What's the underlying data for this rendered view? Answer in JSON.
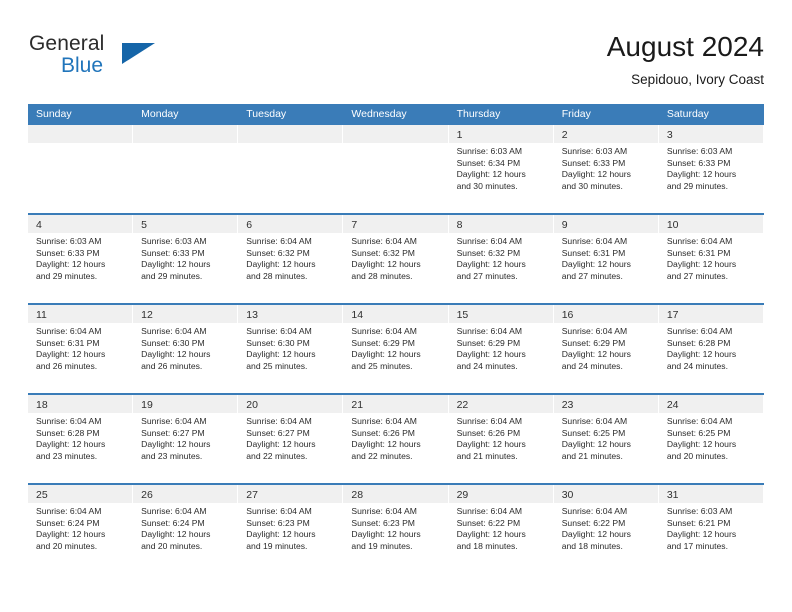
{
  "brand": {
    "name_part1": "General",
    "name_part2": "Blue",
    "flag_icon": "blue-triangle-flag-icon"
  },
  "header": {
    "title": "August 2024",
    "subtitle": "Sepidouo, Ivory Coast"
  },
  "colors": {
    "header_blue": "#3a7cb8",
    "brand_blue": "#2175bb",
    "day_band_gray": "#f0f0f0",
    "text": "#2b2b2b"
  },
  "weekdays": [
    "Sunday",
    "Monday",
    "Tuesday",
    "Wednesday",
    "Thursday",
    "Friday",
    "Saturday"
  ],
  "weeks": [
    [
      {
        "day": "",
        "empty": true
      },
      {
        "day": "",
        "empty": true
      },
      {
        "day": "",
        "empty": true
      },
      {
        "day": "",
        "empty": true
      },
      {
        "day": "1",
        "sunrise": "Sunrise: 6:03 AM",
        "sunset": "Sunset: 6:34 PM",
        "daylight_line1": "Daylight: 12 hours",
        "daylight_line2": "and 30 minutes."
      },
      {
        "day": "2",
        "sunrise": "Sunrise: 6:03 AM",
        "sunset": "Sunset: 6:33 PM",
        "daylight_line1": "Daylight: 12 hours",
        "daylight_line2": "and 30 minutes."
      },
      {
        "day": "3",
        "sunrise": "Sunrise: 6:03 AM",
        "sunset": "Sunset: 6:33 PM",
        "daylight_line1": "Daylight: 12 hours",
        "daylight_line2": "and 29 minutes."
      }
    ],
    [
      {
        "day": "4",
        "sunrise": "Sunrise: 6:03 AM",
        "sunset": "Sunset: 6:33 PM",
        "daylight_line1": "Daylight: 12 hours",
        "daylight_line2": "and 29 minutes."
      },
      {
        "day": "5",
        "sunrise": "Sunrise: 6:03 AM",
        "sunset": "Sunset: 6:33 PM",
        "daylight_line1": "Daylight: 12 hours",
        "daylight_line2": "and 29 minutes."
      },
      {
        "day": "6",
        "sunrise": "Sunrise: 6:04 AM",
        "sunset": "Sunset: 6:32 PM",
        "daylight_line1": "Daylight: 12 hours",
        "daylight_line2": "and 28 minutes."
      },
      {
        "day": "7",
        "sunrise": "Sunrise: 6:04 AM",
        "sunset": "Sunset: 6:32 PM",
        "daylight_line1": "Daylight: 12 hours",
        "daylight_line2": "and 28 minutes."
      },
      {
        "day": "8",
        "sunrise": "Sunrise: 6:04 AM",
        "sunset": "Sunset: 6:32 PM",
        "daylight_line1": "Daylight: 12 hours",
        "daylight_line2": "and 27 minutes."
      },
      {
        "day": "9",
        "sunrise": "Sunrise: 6:04 AM",
        "sunset": "Sunset: 6:31 PM",
        "daylight_line1": "Daylight: 12 hours",
        "daylight_line2": "and 27 minutes."
      },
      {
        "day": "10",
        "sunrise": "Sunrise: 6:04 AM",
        "sunset": "Sunset: 6:31 PM",
        "daylight_line1": "Daylight: 12 hours",
        "daylight_line2": "and 27 minutes."
      }
    ],
    [
      {
        "day": "11",
        "sunrise": "Sunrise: 6:04 AM",
        "sunset": "Sunset: 6:31 PM",
        "daylight_line1": "Daylight: 12 hours",
        "daylight_line2": "and 26 minutes."
      },
      {
        "day": "12",
        "sunrise": "Sunrise: 6:04 AM",
        "sunset": "Sunset: 6:30 PM",
        "daylight_line1": "Daylight: 12 hours",
        "daylight_line2": "and 26 minutes."
      },
      {
        "day": "13",
        "sunrise": "Sunrise: 6:04 AM",
        "sunset": "Sunset: 6:30 PM",
        "daylight_line1": "Daylight: 12 hours",
        "daylight_line2": "and 25 minutes."
      },
      {
        "day": "14",
        "sunrise": "Sunrise: 6:04 AM",
        "sunset": "Sunset: 6:29 PM",
        "daylight_line1": "Daylight: 12 hours",
        "daylight_line2": "and 25 minutes."
      },
      {
        "day": "15",
        "sunrise": "Sunrise: 6:04 AM",
        "sunset": "Sunset: 6:29 PM",
        "daylight_line1": "Daylight: 12 hours",
        "daylight_line2": "and 24 minutes."
      },
      {
        "day": "16",
        "sunrise": "Sunrise: 6:04 AM",
        "sunset": "Sunset: 6:29 PM",
        "daylight_line1": "Daylight: 12 hours",
        "daylight_line2": "and 24 minutes."
      },
      {
        "day": "17",
        "sunrise": "Sunrise: 6:04 AM",
        "sunset": "Sunset: 6:28 PM",
        "daylight_line1": "Daylight: 12 hours",
        "daylight_line2": "and 24 minutes."
      }
    ],
    [
      {
        "day": "18",
        "sunrise": "Sunrise: 6:04 AM",
        "sunset": "Sunset: 6:28 PM",
        "daylight_line1": "Daylight: 12 hours",
        "daylight_line2": "and 23 minutes."
      },
      {
        "day": "19",
        "sunrise": "Sunrise: 6:04 AM",
        "sunset": "Sunset: 6:27 PM",
        "daylight_line1": "Daylight: 12 hours",
        "daylight_line2": "and 23 minutes."
      },
      {
        "day": "20",
        "sunrise": "Sunrise: 6:04 AM",
        "sunset": "Sunset: 6:27 PM",
        "daylight_line1": "Daylight: 12 hours",
        "daylight_line2": "and 22 minutes."
      },
      {
        "day": "21",
        "sunrise": "Sunrise: 6:04 AM",
        "sunset": "Sunset: 6:26 PM",
        "daylight_line1": "Daylight: 12 hours",
        "daylight_line2": "and 22 minutes."
      },
      {
        "day": "22",
        "sunrise": "Sunrise: 6:04 AM",
        "sunset": "Sunset: 6:26 PM",
        "daylight_line1": "Daylight: 12 hours",
        "daylight_line2": "and 21 minutes."
      },
      {
        "day": "23",
        "sunrise": "Sunrise: 6:04 AM",
        "sunset": "Sunset: 6:25 PM",
        "daylight_line1": "Daylight: 12 hours",
        "daylight_line2": "and 21 minutes."
      },
      {
        "day": "24",
        "sunrise": "Sunrise: 6:04 AM",
        "sunset": "Sunset: 6:25 PM",
        "daylight_line1": "Daylight: 12 hours",
        "daylight_line2": "and 20 minutes."
      }
    ],
    [
      {
        "day": "25",
        "sunrise": "Sunrise: 6:04 AM",
        "sunset": "Sunset: 6:24 PM",
        "daylight_line1": "Daylight: 12 hours",
        "daylight_line2": "and 20 minutes."
      },
      {
        "day": "26",
        "sunrise": "Sunrise: 6:04 AM",
        "sunset": "Sunset: 6:24 PM",
        "daylight_line1": "Daylight: 12 hours",
        "daylight_line2": "and 20 minutes."
      },
      {
        "day": "27",
        "sunrise": "Sunrise: 6:04 AM",
        "sunset": "Sunset: 6:23 PM",
        "daylight_line1": "Daylight: 12 hours",
        "daylight_line2": "and 19 minutes."
      },
      {
        "day": "28",
        "sunrise": "Sunrise: 6:04 AM",
        "sunset": "Sunset: 6:23 PM",
        "daylight_line1": "Daylight: 12 hours",
        "daylight_line2": "and 19 minutes."
      },
      {
        "day": "29",
        "sunrise": "Sunrise: 6:04 AM",
        "sunset": "Sunset: 6:22 PM",
        "daylight_line1": "Daylight: 12 hours",
        "daylight_line2": "and 18 minutes."
      },
      {
        "day": "30",
        "sunrise": "Sunrise: 6:04 AM",
        "sunset": "Sunset: 6:22 PM",
        "daylight_line1": "Daylight: 12 hours",
        "daylight_line2": "and 18 minutes."
      },
      {
        "day": "31",
        "sunrise": "Sunrise: 6:03 AM",
        "sunset": "Sunset: 6:21 PM",
        "daylight_line1": "Daylight: 12 hours",
        "daylight_line2": "and 17 minutes."
      }
    ]
  ]
}
